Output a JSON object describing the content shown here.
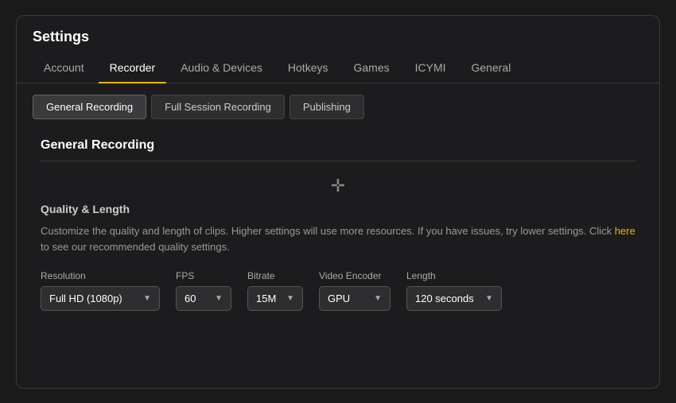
{
  "window": {
    "title": "Settings"
  },
  "nav": {
    "tabs": [
      {
        "id": "account",
        "label": "Account",
        "active": false
      },
      {
        "id": "recorder",
        "label": "Recorder",
        "active": true
      },
      {
        "id": "audio-devices",
        "label": "Audio & Devices",
        "active": false
      },
      {
        "id": "hotkeys",
        "label": "Hotkeys",
        "active": false
      },
      {
        "id": "games",
        "label": "Games",
        "active": false
      },
      {
        "id": "icymi",
        "label": "ICYMI",
        "active": false
      },
      {
        "id": "general",
        "label": "General",
        "active": false
      }
    ]
  },
  "sub_tabs": {
    "tabs": [
      {
        "id": "general-recording",
        "label": "General Recording",
        "active": true
      },
      {
        "id": "full-session",
        "label": "Full Session Recording",
        "active": false
      },
      {
        "id": "publishing",
        "label": "Publishing",
        "active": false
      }
    ]
  },
  "section": {
    "title": "General Recording",
    "subsection_label": "Quality & Length",
    "description_parts": {
      "before_link": "Customize the quality and length of clips. Higher settings will use more resources. If you have issues, try lower settings. Click ",
      "link_text": "here",
      "after_link": " to see our recommended quality settings."
    }
  },
  "controls": {
    "resolution": {
      "label": "Resolution",
      "value": "Full HD (1080p)",
      "arrow": "▼"
    },
    "fps": {
      "label": "FPS",
      "value": "60",
      "arrow": "▼"
    },
    "bitrate": {
      "label": "Bitrate",
      "value": "15M",
      "arrow": "▼"
    },
    "encoder": {
      "label": "Video Encoder",
      "value": "GPU",
      "arrow": "▼"
    },
    "length": {
      "label": "Length",
      "value": "120 seconds",
      "arrow": "▼"
    }
  }
}
